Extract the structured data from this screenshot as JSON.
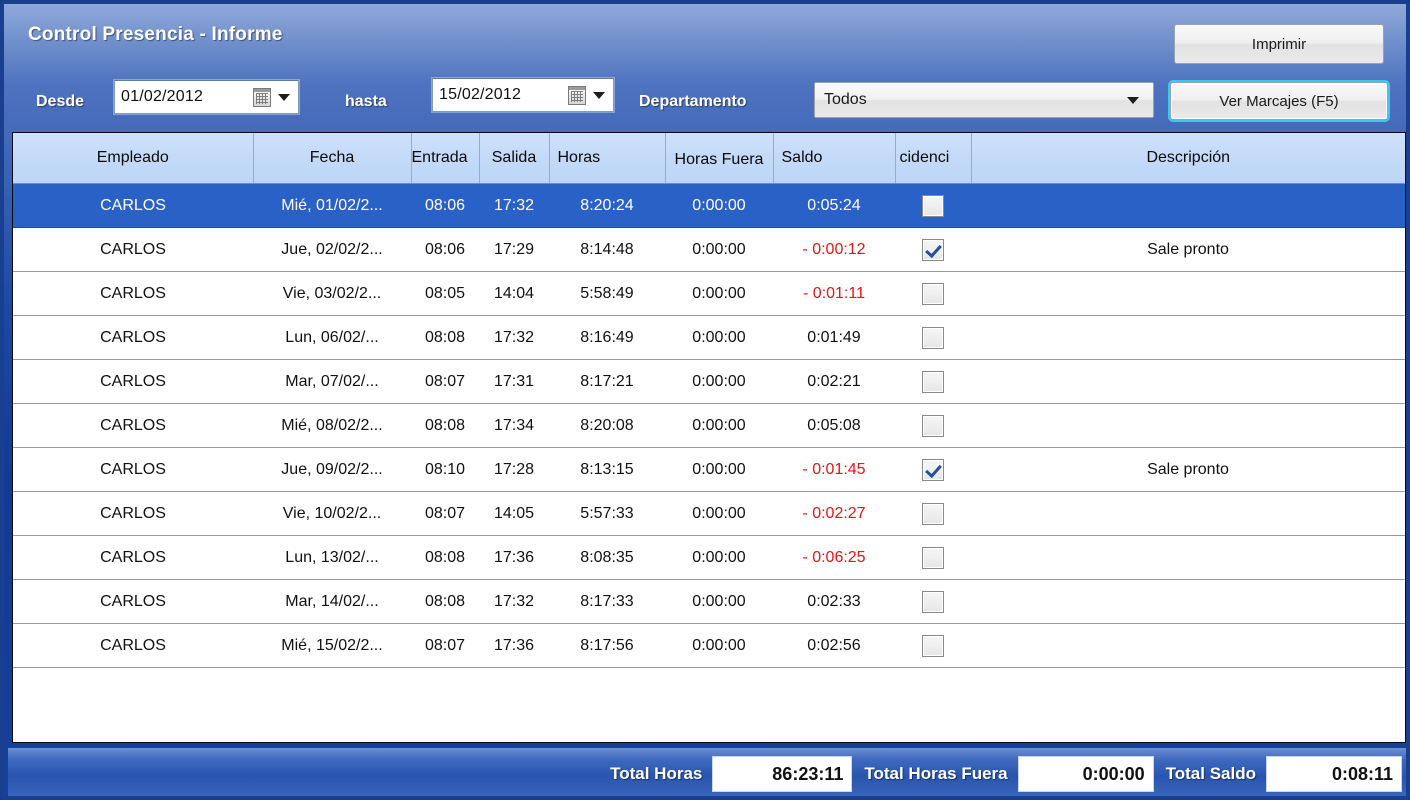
{
  "window": {
    "title": "Control Presencia - Informe"
  },
  "toolbar": {
    "desde_label": "Desde",
    "desde_value": "01/02/2012",
    "hasta_label": "hasta",
    "hasta_value": "15/02/2012",
    "departamento_label": "Departamento",
    "departamento_value": "Todos",
    "print_button": "Imprimir",
    "ver_marcajes_button": "Ver Marcajes (F5)"
  },
  "grid": {
    "columns": [
      "Empleado",
      "Fecha",
      "Entrada",
      "Salida",
      "Horas",
      "Horas Fuera",
      "Saldo",
      "cidenci",
      "Descripción"
    ],
    "rows": [
      {
        "empleado": "CARLOS",
        "fecha": "Mié, 01/02/2...",
        "entrada": "08:06",
        "salida": "17:32",
        "horas": "8:20:24",
        "horas_fuera": "0:00:00",
        "saldo": "0:05:24",
        "saldo_negative": false,
        "incidencia": false,
        "descripcion": "",
        "selected": true
      },
      {
        "empleado": "CARLOS",
        "fecha": "Jue, 02/02/2...",
        "entrada": "08:06",
        "salida": "17:29",
        "horas": "8:14:48",
        "horas_fuera": "0:00:00",
        "saldo": "- 0:00:12",
        "saldo_negative": true,
        "incidencia": true,
        "descripcion": "Sale pronto",
        "selected": false
      },
      {
        "empleado": "CARLOS",
        "fecha": "Vie, 03/02/2...",
        "entrada": "08:05",
        "salida": "14:04",
        "horas": "5:58:49",
        "horas_fuera": "0:00:00",
        "saldo": "- 0:01:11",
        "saldo_negative": true,
        "incidencia": false,
        "descripcion": "",
        "selected": false
      },
      {
        "empleado": "CARLOS",
        "fecha": "Lun, 06/02/...",
        "entrada": "08:08",
        "salida": "17:32",
        "horas": "8:16:49",
        "horas_fuera": "0:00:00",
        "saldo": "0:01:49",
        "saldo_negative": false,
        "incidencia": false,
        "descripcion": "",
        "selected": false
      },
      {
        "empleado": "CARLOS",
        "fecha": "Mar, 07/02/...",
        "entrada": "08:07",
        "salida": "17:31",
        "horas": "8:17:21",
        "horas_fuera": "0:00:00",
        "saldo": "0:02:21",
        "saldo_negative": false,
        "incidencia": false,
        "descripcion": "",
        "selected": false
      },
      {
        "empleado": "CARLOS",
        "fecha": "Mié, 08/02/2...",
        "entrada": "08:08",
        "salida": "17:34",
        "horas": "8:20:08",
        "horas_fuera": "0:00:00",
        "saldo": "0:05:08",
        "saldo_negative": false,
        "incidencia": false,
        "descripcion": "",
        "selected": false
      },
      {
        "empleado": "CARLOS",
        "fecha": "Jue, 09/02/2...",
        "entrada": "08:10",
        "salida": "17:28",
        "horas": "8:13:15",
        "horas_fuera": "0:00:00",
        "saldo": "- 0:01:45",
        "saldo_negative": true,
        "incidencia": true,
        "descripcion": "Sale pronto",
        "selected": false
      },
      {
        "empleado": "CARLOS",
        "fecha": "Vie, 10/02/2...",
        "entrada": "08:07",
        "salida": "14:05",
        "horas": "5:57:33",
        "horas_fuera": "0:00:00",
        "saldo": "- 0:02:27",
        "saldo_negative": true,
        "incidencia": false,
        "descripcion": "",
        "selected": false
      },
      {
        "empleado": "CARLOS",
        "fecha": "Lun, 13/02/...",
        "entrada": "08:08",
        "salida": "17:36",
        "horas": "8:08:35",
        "horas_fuera": "0:00:00",
        "saldo": "- 0:06:25",
        "saldo_negative": true,
        "incidencia": false,
        "descripcion": "",
        "selected": false
      },
      {
        "empleado": "CARLOS",
        "fecha": "Mar, 14/02/...",
        "entrada": "08:08",
        "salida": "17:32",
        "horas": "8:17:33",
        "horas_fuera": "0:00:00",
        "saldo": "0:02:33",
        "saldo_negative": false,
        "incidencia": false,
        "descripcion": "",
        "selected": false
      },
      {
        "empleado": "CARLOS",
        "fecha": "Mié, 15/02/2...",
        "entrada": "08:07",
        "salida": "17:36",
        "horas": "8:17:56",
        "horas_fuera": "0:00:00",
        "saldo": "0:02:56",
        "saldo_negative": false,
        "incidencia": false,
        "descripcion": "",
        "selected": false
      }
    ]
  },
  "footer": {
    "total_horas_label": "Total Horas",
    "total_horas_value": "86:23:11",
    "total_horas_fuera_label": "Total Horas Fuera",
    "total_horas_fuera_value": "0:00:00",
    "total_saldo_label": "Total Saldo",
    "total_saldo_value": "0:08:11"
  },
  "colors": {
    "titlebar_blue": "#123a93",
    "selection_blue": "#2a61c6",
    "header_blue": "#c3daf8",
    "negative_red": "#e81414",
    "focus_cyan": "#3bc9f0"
  }
}
